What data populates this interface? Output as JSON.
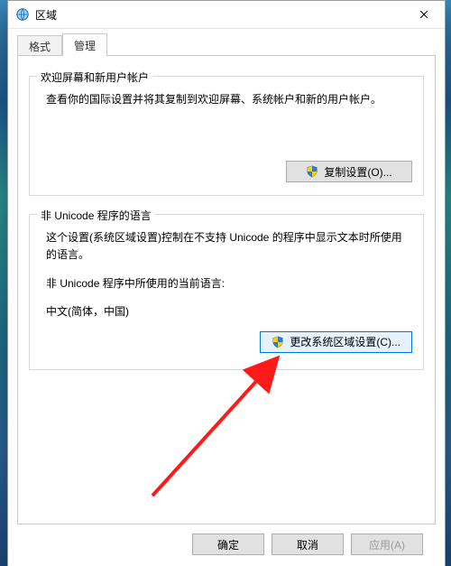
{
  "window": {
    "title": "区域"
  },
  "tabs": {
    "format": "格式",
    "admin": "管理"
  },
  "group_welcome": {
    "legend": "欢迎屏幕和新用户帐户",
    "desc": "查看你的国际设置并将其复制到欢迎屏幕、系统帐户和新的用户帐户。",
    "copy_button": "复制设置(O)..."
  },
  "group_locale": {
    "legend": "非 Unicode 程序的语言",
    "desc": "这个设置(系统区域设置)控制在不支持 Unicode 的程序中显示文本时所使用的语言。",
    "current_label": "非 Unicode 程序中所使用的当前语言:",
    "current_value": "中文(简体，中国)",
    "change_button": "更改系统区域设置(C)..."
  },
  "buttons": {
    "ok": "确定",
    "cancel": "取消",
    "apply": "应用(A)"
  }
}
